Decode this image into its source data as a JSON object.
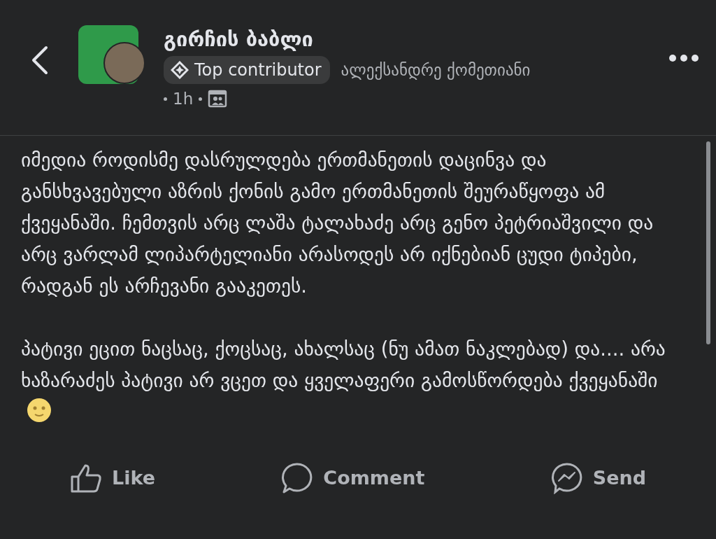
{
  "header": {
    "group_name": "გირჩის ბაბლი",
    "badge": "Top contributor",
    "author": "ალექსანდრე ქომეთიანი",
    "time": "1h"
  },
  "post": {
    "paragraphs": [
      "იმედია როდისმე დასრულდება ერთმანეთის დაცინვა და განსხვავებული აზრის ქონის გამო ერთმანეთის შეურაწყოფა ამ ქვეყანაში. ჩემთვის არც ლაშა ტალახაძე არც გენო პეტრიაშვილი და არც ვარლამ ლიპარტელიანი არასოდეს არ იქნებიან ცუდი ტიპები, რადგან ეს არჩევანი გააკეთეს.",
      "პატივი ეცით ნაცსაც, ქოცსაც, ახალსაც (ნუ ამათ ნაკლებად) და.... არა ხაზარაძეს პატივი არ ვცეთ და ყველაფერი გამოსწორდება ქვეყანაში"
    ]
  },
  "actions": [
    {
      "kind": "like",
      "label": "Like"
    },
    {
      "kind": "comment",
      "label": "Comment"
    },
    {
      "kind": "send",
      "label": "Send"
    }
  ]
}
